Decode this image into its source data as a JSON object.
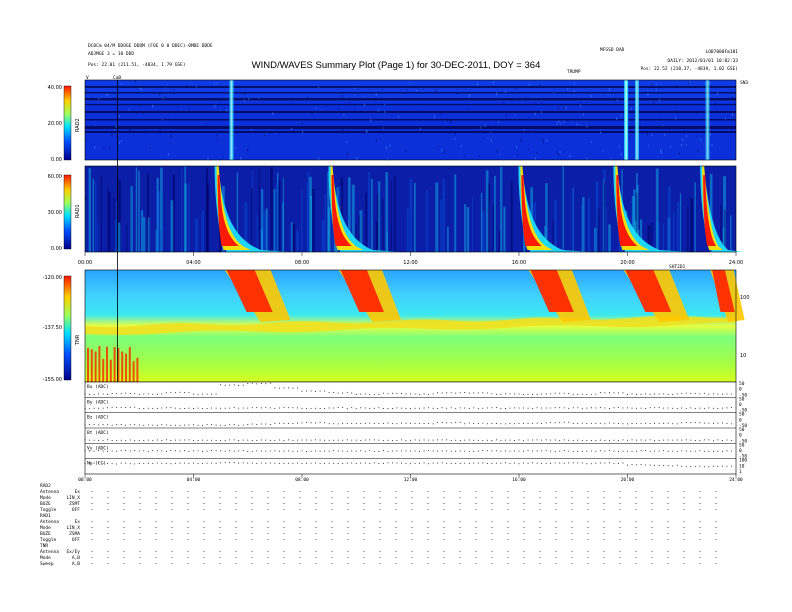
{
  "chart_data": [
    {
      "type": "heatmap",
      "panel": "RAD2",
      "title": "WIND/WAVES Summary Plot (Page 1) for 30-DEC-2011, DOY = 364",
      "header_left": [
        "DC0Cm 04/M DDOGE DDDM (FOE 0 0 DDEC)-0MDE DDDE",
        "ADJMGE 3 = 10 DDD"
      ],
      "header_right": [
        "DAILY: 2012/01/01 10:02:33",
        "LOB7000Fm101"
      ],
      "header_mid": [
        "MFGSD DAD",
        "TRUMP"
      ],
      "pos_left": "Pos:   22.01 (211.51, -4834, 1.79 GSE)",
      "pos_right": "Pos:   22.52 (210.37, -4839, 1.02 GSE)",
      "ylabel": "RAD2",
      "y_ticks": [
        "40.00",
        "20.00",
        "0.00"
      ],
      "ylim": [
        0,
        40
      ],
      "event_label": "CaB",
      "corner_labels": [
        "V",
        "SN3"
      ],
      "bursts": [
        {
          "hour": 5.4,
          "strength": 0.75
        },
        {
          "hour": 19.95,
          "strength": 0.9
        },
        {
          "hour": 20.35,
          "strength": 0.7
        },
        {
          "hour": 22.95,
          "strength": 0.6
        }
      ]
    },
    {
      "type": "heatmap",
      "panel": "RAD1",
      "ylabel": "RAD1",
      "y_ticks": [
        "60.00",
        "30.00",
        "0.00"
      ],
      "ylim": [
        0,
        60
      ],
      "x_ticks": [
        "00:00",
        "04:00",
        "08:00",
        "12:00",
        "16:00",
        "20:00",
        "24:00"
      ],
      "bursts": [
        {
          "hour": 5.0,
          "strength": 1.0
        },
        {
          "hour": 9.2,
          "strength": 0.95
        },
        {
          "hour": 16.2,
          "strength": 0.95
        },
        {
          "hour": 19.7,
          "strength": 1.0
        },
        {
          "hour": 22.9,
          "strength": 0.55
        }
      ]
    },
    {
      "type": "heatmap",
      "panel": "TNR",
      "ylabel": "TNR",
      "y_ticks": [
        "-120.00",
        "-137.50",
        "-155.00"
      ],
      "ylim": [
        -155,
        -120
      ],
      "right_ticks": [
        "100",
        "10"
      ],
      "top_right_label": "SHT2D1"
    },
    {
      "type": "line",
      "panel": "ancillary",
      "series": [
        {
          "name": "Bx (ADC)",
          "right_ticks": [
            "50",
            "0",
            "-50"
          ],
          "values": [
            0.2,
            0.25,
            0.2,
            0.3,
            0.2,
            0.8,
            0.9,
            0.6,
            0.4,
            0.3,
            0.2,
            0.25,
            0.2,
            0.3,
            0.3,
            0.2,
            0.2,
            0.25,
            0.2,
            0.3,
            0.2,
            0.2,
            0.25,
            0.2
          ]
        },
        {
          "name": "By (ADC)",
          "right_ticks": [
            "50",
            "0",
            "-50"
          ],
          "values": [
            0.3,
            0.35,
            0.3,
            0.3,
            0.3,
            0.3,
            0.32,
            0.3,
            0.3,
            0.3,
            0.3,
            0.3,
            0.3,
            0.3,
            0.3,
            0.3,
            0.3,
            0.3,
            0.3,
            0.3,
            0.3,
            0.3,
            0.3,
            0.3
          ]
        },
        {
          "name": "Bz (ADC)",
          "right_ticks": [
            "50",
            "0",
            "-50"
          ],
          "values": [
            0.2,
            0.2,
            0.2,
            0.2,
            0.2,
            0.2,
            0.25,
            0.3,
            0.35,
            0.3,
            0.3,
            0.3,
            0.3,
            0.35,
            0.3,
            0.3,
            0.3,
            0.35,
            0.3,
            0.3,
            0.3,
            0.3,
            0.35,
            0.3
          ]
        },
        {
          "name": "Bt (ADC)",
          "right_ticks": [
            "50",
            "0",
            "-50"
          ],
          "values": [
            0.2,
            0.2,
            0.2,
            0.2,
            0.2,
            0.2,
            0.2,
            0.2,
            0.2,
            0.2,
            0.2,
            0.2,
            0.2,
            0.2,
            0.2,
            0.2,
            0.2,
            0.2,
            0.2,
            0.2,
            0.2,
            0.2,
            0.2,
            0.2
          ]
        },
        {
          "name": "Vy (ADC)",
          "right_ticks": [
            "50",
            "0",
            "-50"
          ],
          "values": [
            0.5,
            0.5,
            0.5,
            0.5,
            0.5,
            0.5,
            0.5,
            0.5,
            0.5,
            0.5,
            0.5,
            0.5,
            0.5,
            0.5,
            0.5,
            0.5,
            0.5,
            0.5,
            0.5,
            0.5,
            0.5,
            0.5,
            0.5,
            0.5
          ]
        },
        {
          "name": "Np (CC)",
          "right_ticks": [
            "100",
            "10",
            "1"
          ],
          "values": [
            0.7,
            0.68,
            0.7,
            0.7,
            0.7,
            0.72,
            0.7,
            0.7,
            0.7,
            0.7,
            0.7,
            0.7,
            0.7,
            0.7,
            0.7,
            0.7,
            0.7,
            0.7,
            0.7,
            0.7,
            0.6,
            0.55,
            0.5,
            0.5
          ]
        }
      ],
      "x_ticks": [
        "00:00",
        "04:00",
        "08:00",
        "12:00",
        "16:00",
        "20:00",
        "24:00"
      ]
    }
  ],
  "footer": {
    "sections": [
      {
        "head": "RAD2",
        "rows": [
          [
            "Antenna",
            "Ex"
          ],
          [
            "Mode",
            "LIN_X"
          ],
          [
            "BUZE",
            "ZSMT"
          ],
          [
            "Toggle",
            "OFF"
          ]
        ]
      },
      {
        "head": "RAD1",
        "rows": [
          [
            "Antenna",
            "Ex"
          ],
          [
            "Mode",
            "LIN_X"
          ],
          [
            "BUZE",
            "ZSMA"
          ],
          [
            "Toggle",
            "OFF"
          ]
        ]
      },
      {
        "head": "TNR",
        "rows": [
          [
            "Antenna",
            "Ex/Ey"
          ],
          [
            "Mode",
            "A,B"
          ],
          [
            "Sweep",
            "A,B"
          ]
        ]
      }
    ]
  },
  "colors": {
    "bg_low": "#00008a",
    "mid": "#00c8ff",
    "high": "#ff1a00"
  }
}
